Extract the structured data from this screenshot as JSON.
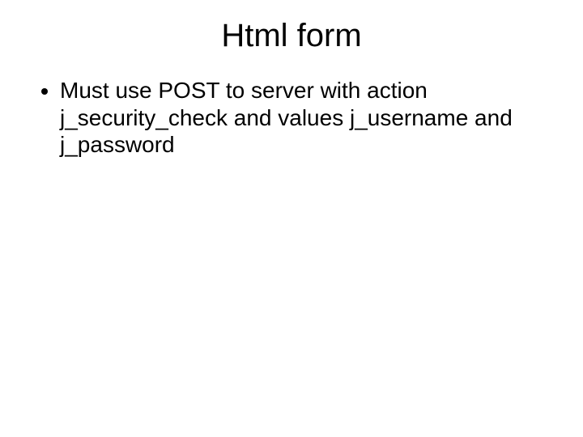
{
  "slide": {
    "title": "Html form",
    "bullets": [
      "Must use POST to server with action j_security_check and values j_username and j_password"
    ]
  }
}
